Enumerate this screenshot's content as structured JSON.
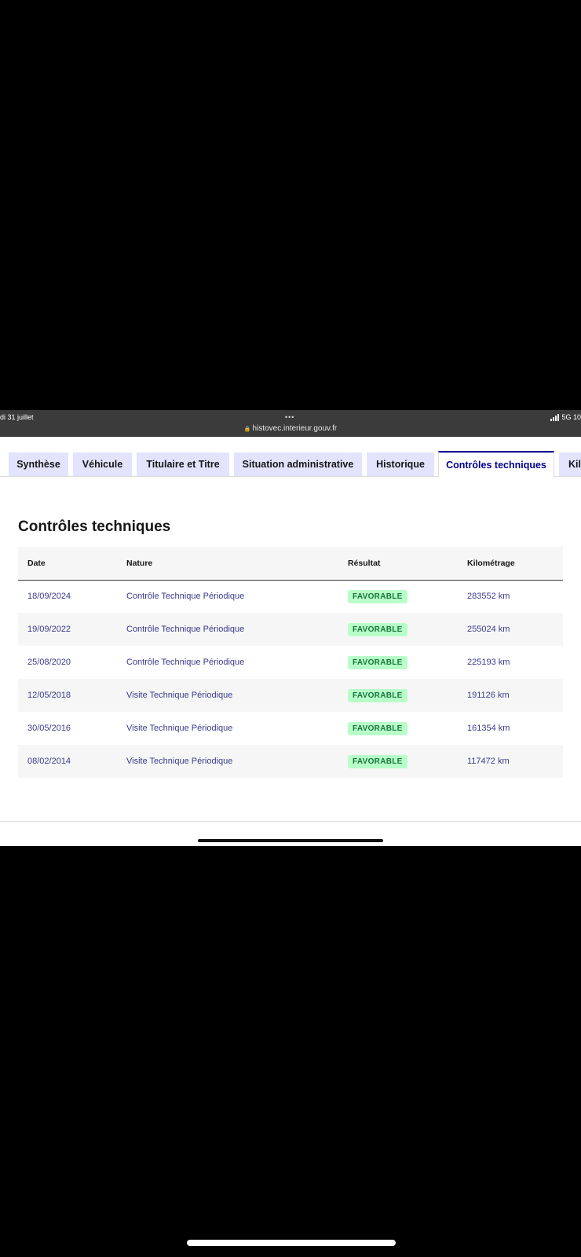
{
  "status_bar": {
    "left_text": "di 31 juillet",
    "dots": "•••",
    "url": "histovec.interieur.gouv.fr",
    "right_text": "5G 10"
  },
  "tabs": [
    {
      "label": "Synthèse"
    },
    {
      "label": "Véhicule"
    },
    {
      "label": "Titulaire et Titre"
    },
    {
      "label": "Situation administrative"
    },
    {
      "label": "Historique"
    },
    {
      "label": "Contrôles techniques",
      "active": true
    },
    {
      "label": "Kil"
    }
  ],
  "section": {
    "title": "Contrôles techniques"
  },
  "table": {
    "headers": [
      "Date",
      "Nature",
      "Résultat",
      "Kilométrage"
    ],
    "rows": [
      {
        "date": "18/09/2024",
        "nature": "Contrôle Technique Périodique",
        "result": "FAVORABLE",
        "km": "283552 km"
      },
      {
        "date": "19/09/2022",
        "nature": "Contrôle Technique Périodique",
        "result": "FAVORABLE",
        "km": "255024 km"
      },
      {
        "date": "25/08/2020",
        "nature": "Contrôle Technique Périodique",
        "result": "FAVORABLE",
        "km": "225193 km"
      },
      {
        "date": "12/05/2018",
        "nature": "Visite Technique Périodique",
        "result": "FAVORABLE",
        "km": "191126 km"
      },
      {
        "date": "30/05/2016",
        "nature": "Visite Technique Périodique",
        "result": "FAVORABLE",
        "km": "161354 km"
      },
      {
        "date": "08/02/2014",
        "nature": "Visite Technique Périodique",
        "result": "FAVORABLE",
        "km": "117472 km"
      }
    ]
  },
  "colors": {
    "accent": "#000091",
    "tab_bg": "#e3e3fd",
    "badge_bg": "#b8fec9",
    "badge_text": "#18753c"
  }
}
